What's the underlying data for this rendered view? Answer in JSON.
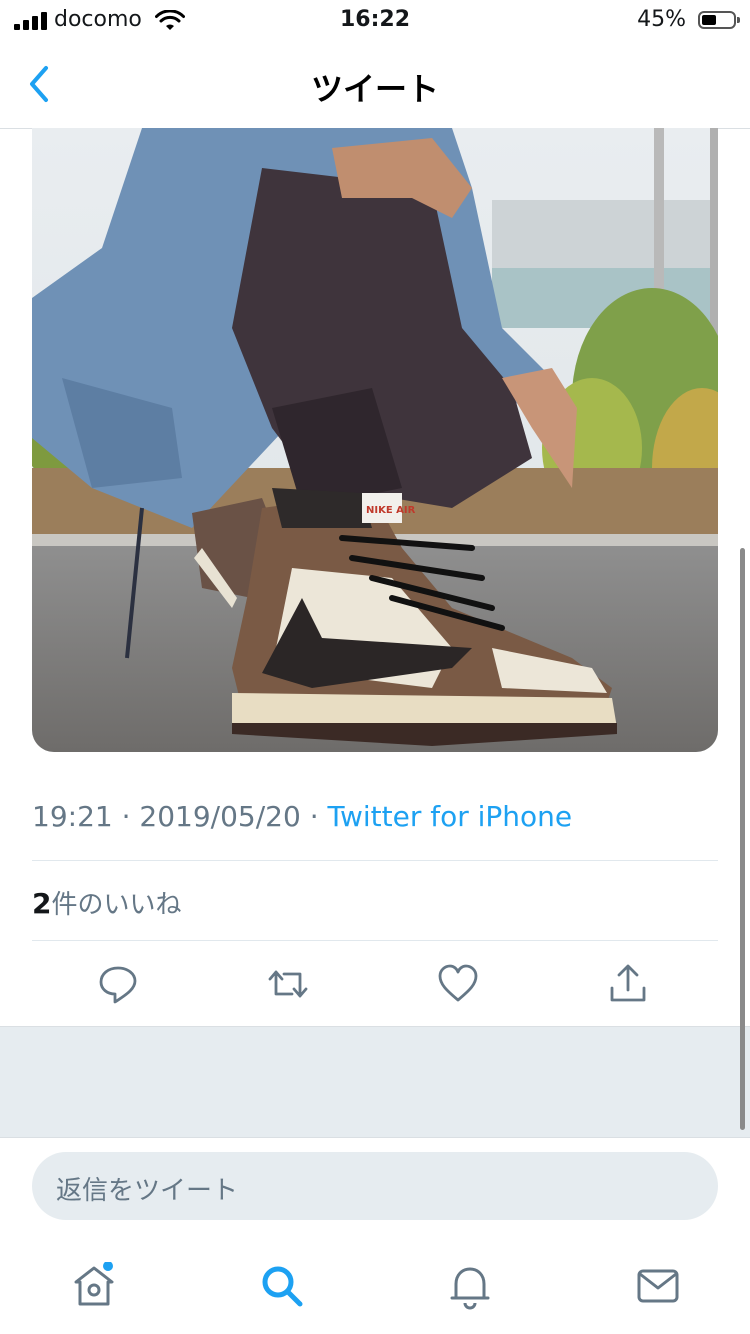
{
  "status": {
    "carrier": "docomo",
    "time": "16:22",
    "battery": "45%"
  },
  "nav": {
    "title": "ツイート"
  },
  "tweet": {
    "time": "19:21",
    "date": "2019/05/20",
    "client": "Twitter for iPhone",
    "like_count": "2",
    "like_label": "件のいいね"
  },
  "reply": {
    "placeholder": "返信をツイート"
  },
  "photo": {
    "shoe_tag": "NIKE AIR"
  },
  "colors": {
    "accent": "#1da1f2",
    "meta": "#657786",
    "band": "#e6ecf0"
  },
  "icons": {
    "back": "chevron-left-icon",
    "actions": [
      "reply-icon",
      "retweet-icon",
      "like-icon",
      "share-icon"
    ],
    "tabs": [
      "home-icon",
      "search-icon",
      "notifications-icon",
      "messages-icon"
    ]
  }
}
